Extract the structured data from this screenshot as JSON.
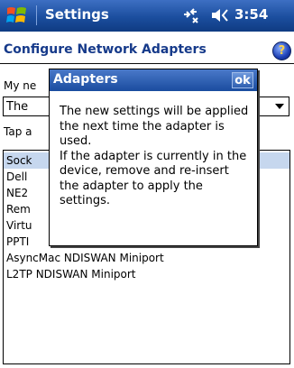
{
  "titlebar": {
    "title": "Settings",
    "time": "3:54"
  },
  "page": {
    "heading": "Configure Network Adapters",
    "my_label": "My ne",
    "dropdown_value": "The",
    "tap_label": "Tap a"
  },
  "adapters": [
    "Sock",
    "Dell",
    "NE2",
    "Rem",
    "Virtu",
    "PPTI",
    "AsyncMac NDISWAN Miniport",
    "L2TP NDISWAN Miniport"
  ],
  "popup": {
    "title": "Adapters",
    "ok_label": "ok",
    "line1": "The new settings will be applied the next time the adapter is used.",
    "line2": "If the adapter is currently in the device, remove and re-insert the adapter to apply the settings."
  },
  "colors": {
    "titlebar": "#1b4e9e",
    "heading": "#163a8a",
    "selection": "#c6d7ee"
  }
}
